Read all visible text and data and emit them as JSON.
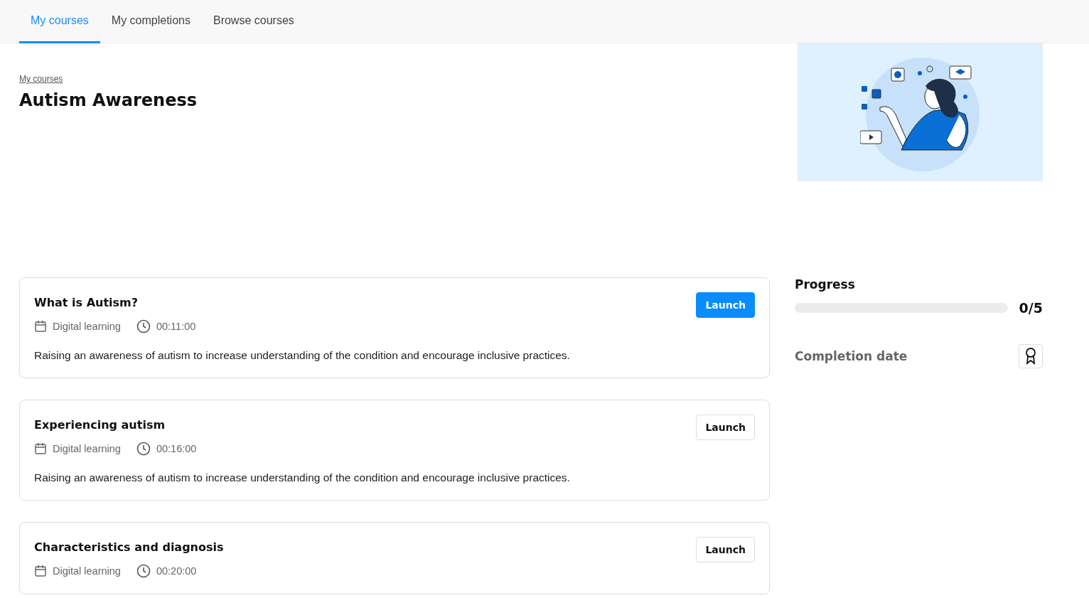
{
  "tabs": [
    {
      "label": "My courses",
      "selected": true
    },
    {
      "label": "My completions",
      "selected": false
    },
    {
      "label": "Browse courses",
      "selected": false
    }
  ],
  "breadcrumb": "My courses",
  "title": "Autism Awareness",
  "modules": [
    {
      "title": "What is Autism?",
      "type": "Digital learning",
      "duration": "00:11:00",
      "description": "Raising an awareness of autism to increase understanding of the condition and encourage inclusive practices.",
      "button": {
        "label": "Launch",
        "kind": "primary"
      }
    },
    {
      "title": "Experiencing autism",
      "type": "Digital learning",
      "duration": "00:16:00",
      "description": "Raising an awareness of autism to increase understanding of the condition and encourage inclusive practices.",
      "button": {
        "label": "Launch",
        "kind": "secondary"
      }
    },
    {
      "title": "Characteristics and diagnosis",
      "type": "Digital learning",
      "duration": "00:20:00",
      "button": {
        "label": "Launch",
        "kind": "secondary"
      }
    }
  ],
  "progress": {
    "heading": "Progress",
    "level": 0,
    "reading": "0/5"
  },
  "completion": {
    "heading": "Completion date"
  }
}
